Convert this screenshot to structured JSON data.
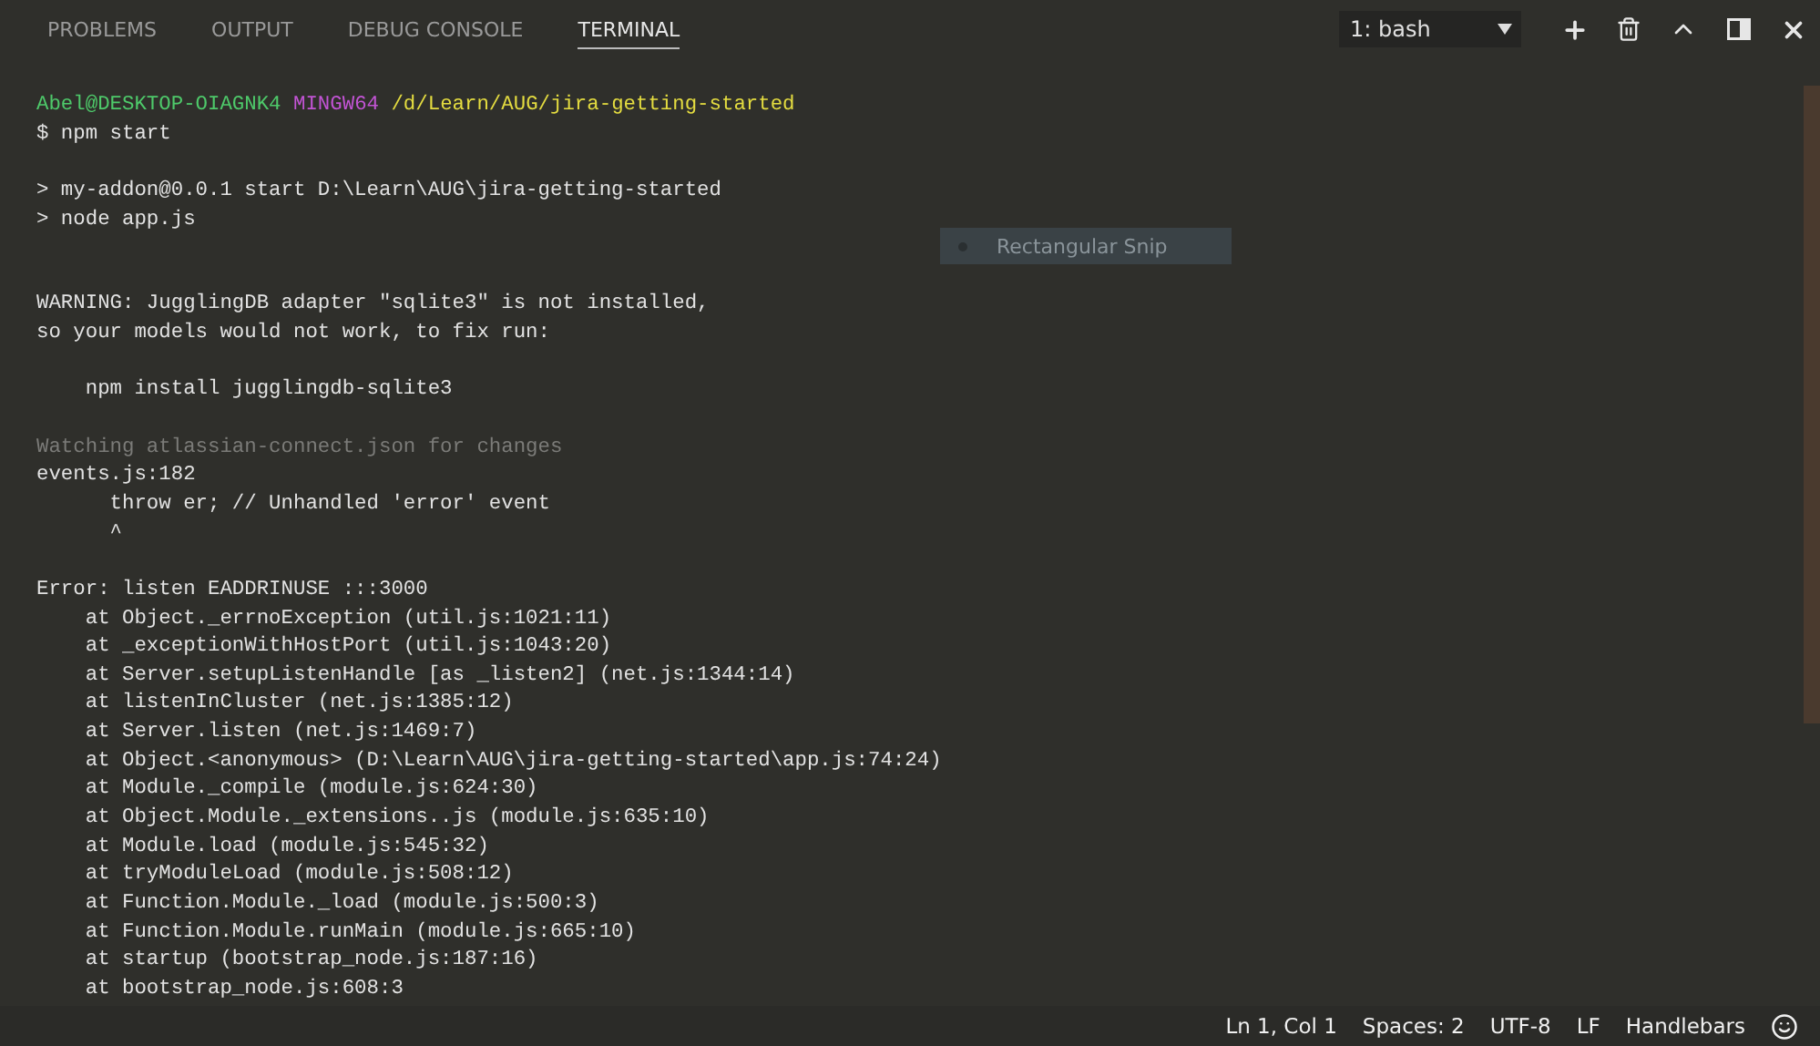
{
  "tabs": [
    {
      "label": "PROBLEMS",
      "selected": false
    },
    {
      "label": "OUTPUT",
      "selected": false
    },
    {
      "label": "DEBUG CONSOLE",
      "selected": false
    },
    {
      "label": "TERMINAL",
      "selected": true
    }
  ],
  "terminal_select": {
    "value": "1: bash"
  },
  "terminal": {
    "lines": [
      {
        "kind": "prompt",
        "user": "Abel@DESKTOP-OIAGNK4",
        "shell": "MINGW64",
        "path": "/d/Learn/AUG/jira-getting-started"
      },
      {
        "kind": "output",
        "text": "$ npm start"
      },
      {
        "kind": "blank"
      },
      {
        "kind": "output",
        "text": "> my-addon@0.0.1 start D:\\Learn\\AUG\\jira-getting-started"
      },
      {
        "kind": "output",
        "text": "> node app.js"
      },
      {
        "kind": "blank"
      },
      {
        "kind": "blank"
      },
      {
        "kind": "output",
        "text": "WARNING: JugglingDB adapter \"sqlite3\" is not installed,"
      },
      {
        "kind": "output",
        "text": "so your models would not work, to fix run:"
      },
      {
        "kind": "blank"
      },
      {
        "kind": "output",
        "text": "    npm install jugglingdb-sqlite3"
      },
      {
        "kind": "blank"
      },
      {
        "kind": "dim",
        "text": "Watching atlassian-connect.json for changes"
      },
      {
        "kind": "output",
        "text": "events.js:182"
      },
      {
        "kind": "output",
        "text": "      throw er; // Unhandled 'error' event"
      },
      {
        "kind": "output",
        "text": "      ^"
      },
      {
        "kind": "blank"
      },
      {
        "kind": "output",
        "text": "Error: listen EADDRINUSE :::3000"
      },
      {
        "kind": "output",
        "text": "    at Object._errnoException (util.js:1021:11)"
      },
      {
        "kind": "output",
        "text": "    at _exceptionWithHostPort (util.js:1043:20)"
      },
      {
        "kind": "output",
        "text": "    at Server.setupListenHandle [as _listen2] (net.js:1344:14)"
      },
      {
        "kind": "output",
        "text": "    at listenInCluster (net.js:1385:12)"
      },
      {
        "kind": "output",
        "text": "    at Server.listen (net.js:1469:7)"
      },
      {
        "kind": "output",
        "text": "    at Object.<anonymous> (D:\\Learn\\AUG\\jira-getting-started\\app.js:74:24)"
      },
      {
        "kind": "output",
        "text": "    at Module._compile (module.js:624:30)"
      },
      {
        "kind": "output",
        "text": "    at Object.Module._extensions..js (module.js:635:10)"
      },
      {
        "kind": "output",
        "text": "    at Module.load (module.js:545:32)"
      },
      {
        "kind": "output",
        "text": "    at tryModuleLoad (module.js:508:12)"
      },
      {
        "kind": "output",
        "text": "    at Function.Module._load (module.js:500:3)"
      },
      {
        "kind": "output",
        "text": "    at Function.Module.runMain (module.js:665:10)"
      },
      {
        "kind": "output",
        "text": "    at startup (bootstrap_node.js:187:16)"
      },
      {
        "kind": "output",
        "text": "    at bootstrap_node.js:608:3"
      }
    ]
  },
  "snip_overlay": {
    "label": "Rectangular Snip"
  },
  "status_bar": {
    "items": [
      "Ln 1, Col 1",
      "Spaces: 2",
      "UTF-8",
      "LF",
      "Handlebars"
    ]
  }
}
